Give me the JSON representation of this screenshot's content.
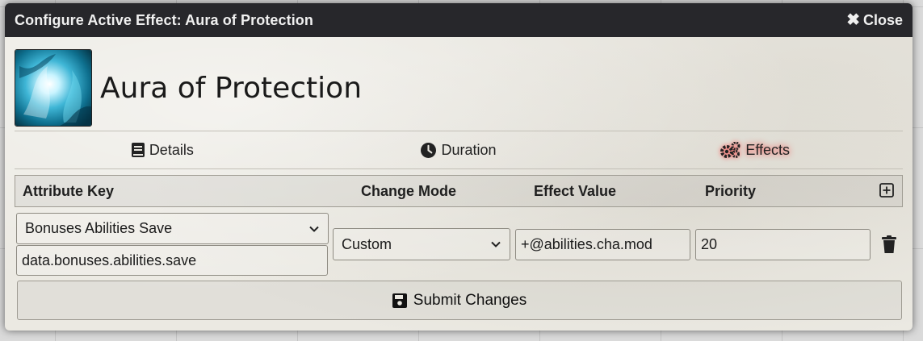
{
  "window": {
    "title": "Configure Active Effect: Aura of Protection",
    "close_label": "Close"
  },
  "effect": {
    "name": "Aura of Protection",
    "image_icon": "aura-of-protection-image"
  },
  "tabs": [
    {
      "label": "Details",
      "icon": "book-icon",
      "active": false
    },
    {
      "label": "Duration",
      "icon": "clock-icon",
      "active": false
    },
    {
      "label": "Effects",
      "icon": "cogs-icon",
      "active": true
    }
  ],
  "changes_table": {
    "headers": {
      "attribute_key": "Attribute Key",
      "change_mode": "Change Mode",
      "effect_value": "Effect Value",
      "priority": "Priority"
    },
    "rows": [
      {
        "attribute_select": "Bonuses Abilities Save",
        "attribute_key": "data.bonuses.abilities.save",
        "change_mode": "Custom",
        "effect_value": "+@abilities.cha.mod",
        "priority": "20"
      }
    ]
  },
  "submit_label": "Submit Changes",
  "colors": {
    "titlebar": "#27272b",
    "active_tab_glow": "#ff3b3b",
    "panel_bg": "#ebe9e2"
  }
}
